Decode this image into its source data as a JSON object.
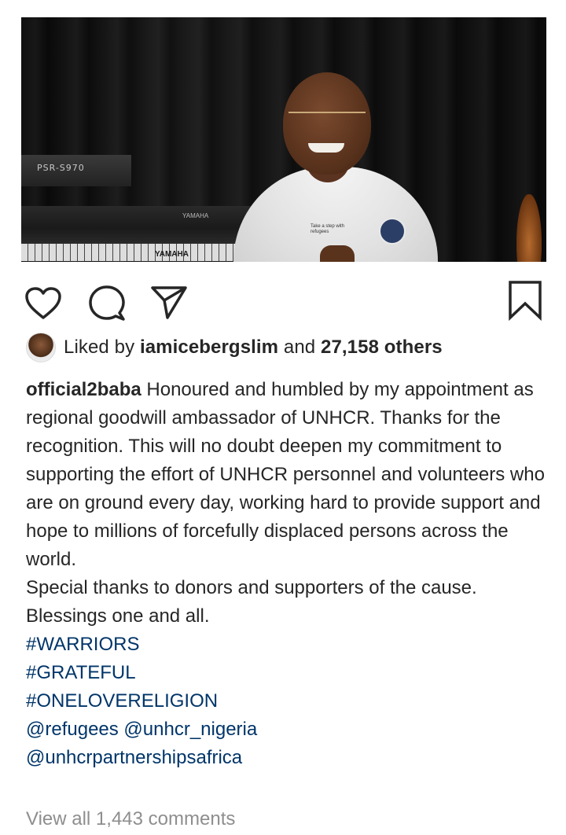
{
  "post": {
    "image": {
      "alt_items": [
        "PSR-S970",
        "YAMAHA",
        "YAMAHA"
      ],
      "shirt_print": "Take a step with refugees"
    },
    "actions": {
      "like_icon": "heart-outline-icon",
      "comment_icon": "comment-bubble-icon",
      "share_icon": "paper-plane-icon",
      "save_icon": "bookmark-outline-icon"
    },
    "likes": {
      "prefix": "Liked by ",
      "user": "iamicebergslim",
      "joiner": " and ",
      "count": "27,158 others"
    },
    "caption": {
      "username": "official2baba",
      "text": " Honoured and humbled by my appointment as regional goodwill ambassador of UNHCR. Thanks for the recognition. This will no doubt deepen my commitment to supporting the effort of UNHCR personnel and volunteers who are on ground every day, working hard to provide support and hope to millions of forcefully displaced persons across the world.",
      "line2": "Special thanks to donors and supporters of the cause. Blessings one and all.",
      "hashtags": [
        "#WARRIORS",
        "#GRATEFUL",
        "#ONELOVERELIGION"
      ],
      "mentions_line1": "@refugees @unhcr_nigeria",
      "mentions_line2": "@unhcrpartnershipsafrica"
    },
    "comments_link": "View all 1,443 comments"
  },
  "colors": {
    "text": "#262626",
    "link": "#003569",
    "muted": "#8e8e8e"
  }
}
